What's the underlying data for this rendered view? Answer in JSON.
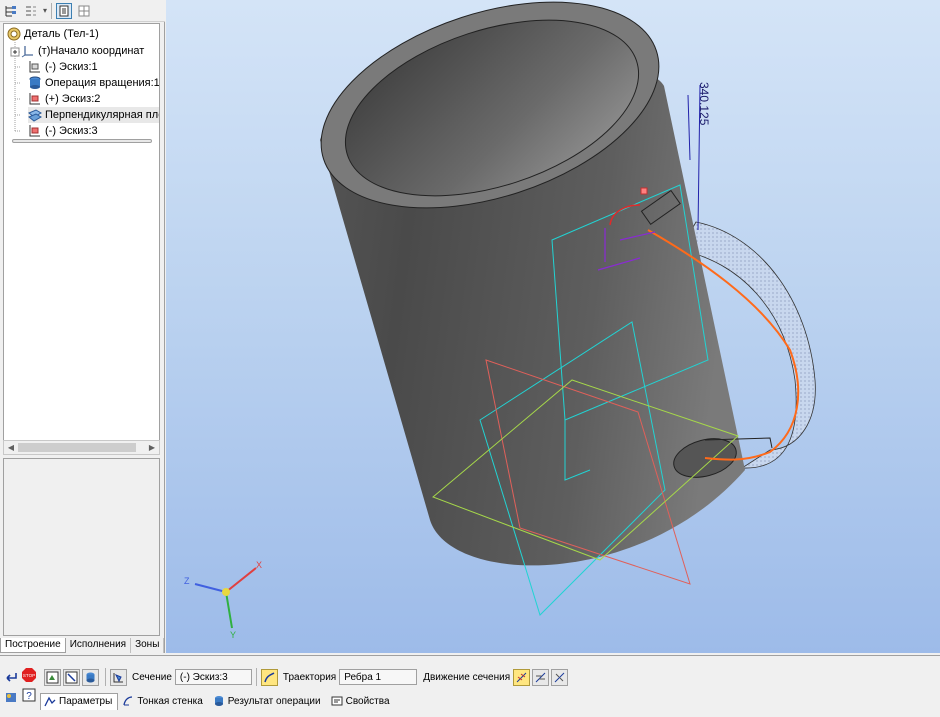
{
  "tree": {
    "items": [
      {
        "label": "Деталь (Тел-1)",
        "icon": "part-icon"
      },
      {
        "label": "(т)Начало координат",
        "icon": "origin-icon"
      },
      {
        "label": "(-) Эскиз:1",
        "icon": "sketch-icon"
      },
      {
        "label": "Операция вращения:1",
        "icon": "revolve-icon"
      },
      {
        "label": "(+) Эскиз:2",
        "icon": "sketch-red-icon"
      },
      {
        "label": "Перпендикулярная плос",
        "icon": "plane-icon"
      },
      {
        "label": "(-) Эскиз:3",
        "icon": "sketch-red-icon"
      }
    ]
  },
  "left_tabs": [
    "Построение",
    "Исполнения",
    "Зоны"
  ],
  "viewport": {
    "dimension_text": "340.125",
    "triad": {
      "x": "X",
      "y": "Y",
      "z": "Z"
    },
    "colors": {
      "cup_dark": "#3c3c3c",
      "cup_light": "#8a8a8a",
      "sketch_cyan": "#22d3d3",
      "sketch_green": "#a6d84a",
      "sketch_red": "#e0605a",
      "trajectory": "#ff6a1a"
    }
  },
  "params": {
    "section_label": "Сечение",
    "section_value": "(-) Эскиз:3",
    "trajectory_label": "Траектория",
    "trajectory_value": "Ребра 1",
    "motion_label": "Движение сечения"
  },
  "bottom_tabs": [
    {
      "label": "Параметры",
      "icon": "params-icon"
    },
    {
      "label": "Тонкая стенка",
      "icon": "thin-wall-icon"
    },
    {
      "label": "Результат операции",
      "icon": "result-icon"
    },
    {
      "label": "Свойства",
      "icon": "properties-icon"
    }
  ]
}
